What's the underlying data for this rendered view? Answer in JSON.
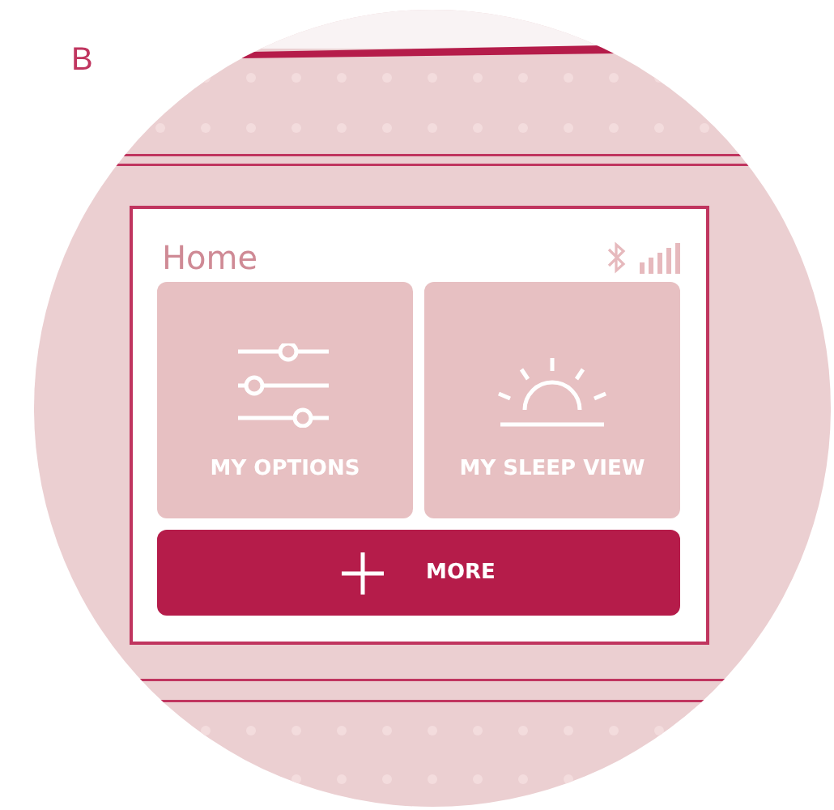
{
  "panel_label": "B",
  "screen": {
    "title": "Home",
    "tiles": [
      {
        "label": "MY OPTIONS",
        "kind": "options"
      },
      {
        "label": "MY SLEEP VIEW",
        "kind": "sleep"
      }
    ],
    "more_button": {
      "label": "MORE"
    }
  }
}
